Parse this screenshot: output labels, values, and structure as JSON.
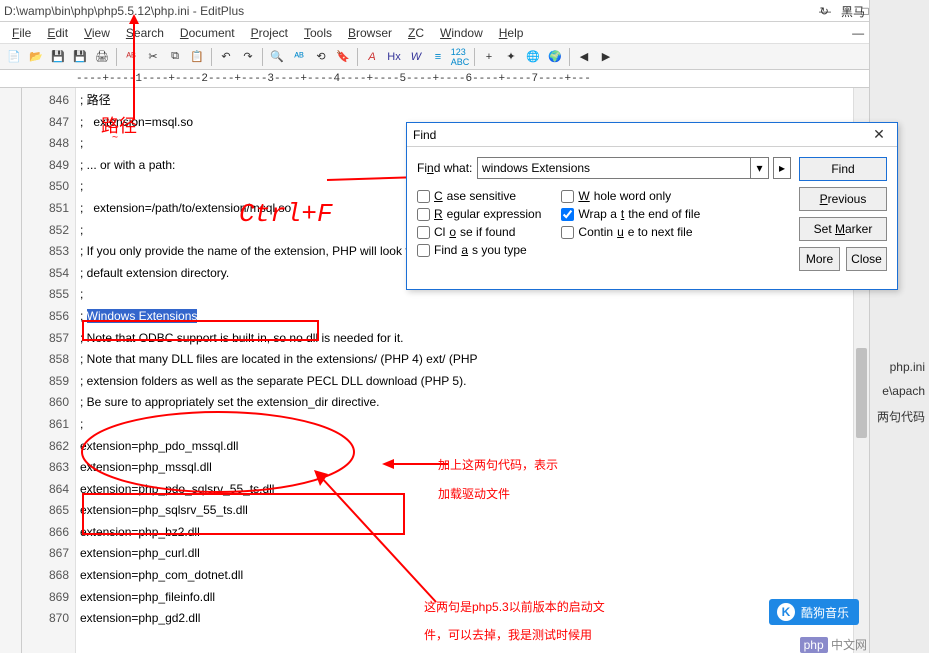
{
  "title": "D:\\wamp\\bin\\php\\php5.5.12\\php.ini - EditPlus",
  "menus": {
    "file": "File",
    "edit": "Edit",
    "view": "View",
    "search": "Search",
    "document": "Document",
    "project": "Project",
    "tools": "Tools",
    "browser": "Browser",
    "zc": "ZC",
    "window": "Window",
    "help": "Help"
  },
  "ruler": "----+----1----+----2----+----3----+----4----+----5----+----6----+----7----+---",
  "lines": [
    {
      "n": 846,
      "t": "; 路径"
    },
    {
      "n": 847,
      "t": ";   extension=msql.so"
    },
    {
      "n": 848,
      "t": ";"
    },
    {
      "n": 849,
      "t": "; ... or with a path:"
    },
    {
      "n": 850,
      "t": ";"
    },
    {
      "n": 851,
      "t": ";   extension=/path/to/extension/msql.so"
    },
    {
      "n": 852,
      "t": ";"
    },
    {
      "n": 853,
      "t": "; If you only provide the name of the extension, PHP will look for it in its"
    },
    {
      "n": 854,
      "t": "; default extension directory."
    },
    {
      "n": 855,
      "t": ";"
    },
    {
      "n": 856,
      "t": "; ",
      "hl": "Windows Extensions"
    },
    {
      "n": 857,
      "t": "; Note that ODBC support is built in, so no dll is needed for it."
    },
    {
      "n": 858,
      "t": "; Note that many DLL files are located in the extensions/ (PHP 4) ext/ (PHP"
    },
    {
      "n": 859,
      "t": "; extension folders as well as the separate PECL DLL download (PHP 5)."
    },
    {
      "n": 860,
      "t": "; Be sure to appropriately set the extension_dir directive."
    },
    {
      "n": 861,
      "t": ";"
    },
    {
      "n": 862,
      "t": "extension=php_pdo_mssql.dll"
    },
    {
      "n": 863,
      "t": "extension=php_mssql.dll"
    },
    {
      "n": 864,
      "t": "extension=php_pdo_sqlsrv_55_ts.dll"
    },
    {
      "n": 865,
      "t": "extension=php_sqlsrv_55_ts.dll"
    },
    {
      "n": 866,
      "t": "extension=php_bz2.dll"
    },
    {
      "n": 867,
      "t": "extension=php_curl.dll"
    },
    {
      "n": 868,
      "t": "extension=php_com_dotnet.dll"
    },
    {
      "n": 869,
      "t": "extension=php_fileinfo.dll"
    },
    {
      "n": 870,
      "t": "extension=php_gd2.dll"
    }
  ],
  "find": {
    "title": "Find",
    "label": "Find what:",
    "value": "windows Extensions",
    "case": "Case sensitive",
    "regex": "Regular expression",
    "closef": "Close if found",
    "fayt": "Find as you type",
    "whole": "Whole word only",
    "wrap": "Wrap at the end of file",
    "cont": "Continue to next file",
    "btn_find": "Find",
    "btn_prev": "Previous",
    "btn_marker": "Set Marker",
    "btn_more": "More",
    "btn_close": "Close"
  },
  "anno": {
    "path": "路径",
    "ctrlf": "Ctrl+F",
    "add": "加上这两句代码，表示\n加载驱动文件",
    "old": "这两句是php5.3以前版本的启动文\n件，可以去掉，我是测试时候用"
  },
  "right_snippets": [
    "php.ini",
    "e\\apach",
    "两句代码"
  ],
  "kugou": "酷狗音乐",
  "php_badge": "php 中文网",
  "top_ext": "黑马"
}
